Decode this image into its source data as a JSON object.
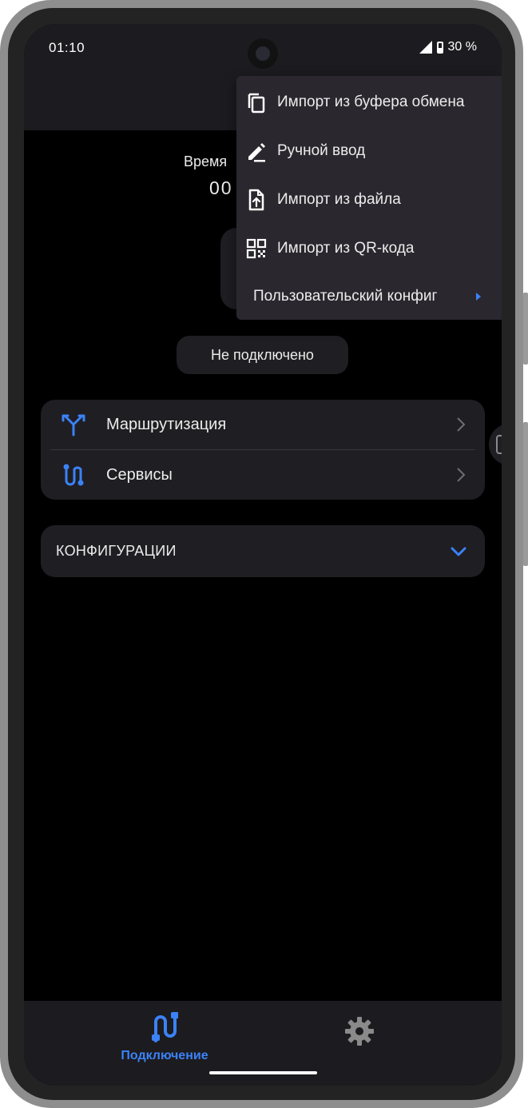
{
  "status_bar": {
    "time": "01:10",
    "battery": "30 %",
    "icons": [
      "camera-icon",
      "signal-icon",
      "battery-icon"
    ]
  },
  "main": {
    "time_label": "Время",
    "time_value": "00",
    "connection_status": "Не подключено"
  },
  "nav_card": {
    "items": [
      {
        "label": "Маршрутизация",
        "icon": "routing-fork-icon"
      },
      {
        "label": "Сервисы",
        "icon": "services-path-icon"
      }
    ]
  },
  "configurations": {
    "title": "КОНФИГУРАЦИИ",
    "expanded": false
  },
  "popup_menu": {
    "items": [
      {
        "label": "Импорт из буфера обмена",
        "icon": "clipboard-copy-icon"
      },
      {
        "label": "Ручной ввод",
        "icon": "pencil-icon"
      },
      {
        "label": "Импорт из файла",
        "icon": "file-upload-icon"
      },
      {
        "label": "Импорт из QR-кода",
        "icon": "qr-code-icon"
      },
      {
        "label": "Пользовательский конфиг",
        "icon": "submenu-arrow-icon"
      }
    ]
  },
  "bottom_nav": {
    "items": [
      {
        "label": "Подключение",
        "icon": "connection-icon",
        "active": true
      },
      {
        "label": "",
        "icon": "gear-icon",
        "active": false
      }
    ]
  },
  "colors": {
    "accent": "#3b82f6",
    "background": "#000000",
    "surface": "#1f1e22",
    "menu_surface": "#2a282e",
    "text": "#ececec"
  }
}
